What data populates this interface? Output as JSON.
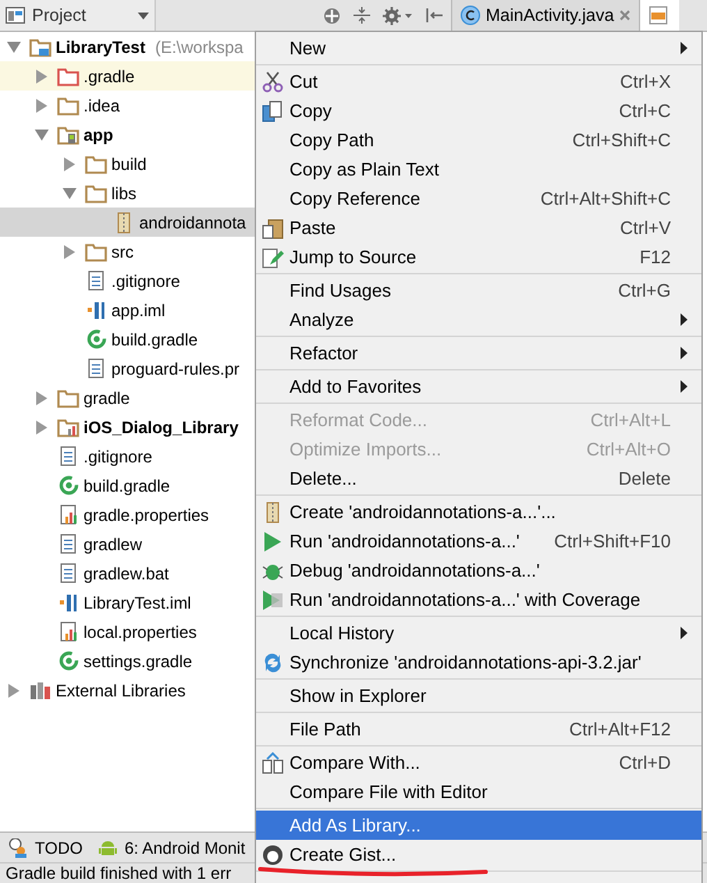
{
  "toolbar": {
    "view_selector": "Project",
    "tabs": [
      {
        "label": "MainActivity.java",
        "kind": "class",
        "selected": false,
        "closable": true
      },
      {
        "kind": "xml",
        "selected": true,
        "closable": false
      }
    ]
  },
  "tree": [
    {
      "label": "LibraryTest",
      "path": "(E:\\workspa",
      "kind": "project",
      "bold": true,
      "expanded": true,
      "selected": false,
      "highlighted": false,
      "children": [
        {
          "label": ".gradle",
          "kind": "excluded-folder",
          "bold": false,
          "expanded": false,
          "selected": false,
          "highlighted": true
        },
        {
          "label": ".idea",
          "kind": "folder",
          "bold": false,
          "expanded": false,
          "selected": false,
          "highlighted": false
        },
        {
          "label": "app",
          "kind": "module",
          "bold": true,
          "expanded": true,
          "selected": false,
          "highlighted": false,
          "children": [
            {
              "label": "build",
              "kind": "folder",
              "bold": false,
              "expanded": false,
              "selected": false,
              "highlighted": false
            },
            {
              "label": "libs",
              "kind": "folder",
              "bold": false,
              "expanded": true,
              "selected": false,
              "highlighted": false,
              "children": [
                {
                  "label": "androidannota",
                  "kind": "jar",
                  "bold": false,
                  "selected": true,
                  "highlighted": false
                }
              ]
            },
            {
              "label": "src",
              "kind": "folder",
              "bold": false,
              "expanded": false,
              "selected": false,
              "highlighted": false
            },
            {
              "label": ".gitignore",
              "kind": "text",
              "bold": false,
              "selected": false,
              "highlighted": false
            },
            {
              "label": "app.iml",
              "kind": "iml",
              "bold": false,
              "selected": false,
              "highlighted": false
            },
            {
              "label": "build.gradle",
              "kind": "gradle",
              "bold": false,
              "selected": false,
              "highlighted": false
            },
            {
              "label": "proguard-rules.pr",
              "kind": "text",
              "bold": false,
              "selected": false,
              "highlighted": false
            }
          ]
        },
        {
          "label": "gradle",
          "kind": "folder",
          "bold": false,
          "expanded": false,
          "selected": false,
          "highlighted": false
        },
        {
          "label": "iOS_Dialog_Library",
          "kind": "library-module",
          "bold": true,
          "expanded": false,
          "selected": false,
          "highlighted": false
        },
        {
          "label": ".gitignore",
          "kind": "text",
          "bold": false,
          "selected": false,
          "highlighted": false
        },
        {
          "label": "build.gradle",
          "kind": "gradle",
          "bold": false,
          "selected": false,
          "highlighted": false
        },
        {
          "label": "gradle.properties",
          "kind": "properties",
          "bold": false,
          "selected": false,
          "highlighted": false
        },
        {
          "label": "gradlew",
          "kind": "text",
          "bold": false,
          "selected": false,
          "highlighted": false
        },
        {
          "label": "gradlew.bat",
          "kind": "text",
          "bold": false,
          "selected": false,
          "highlighted": false
        },
        {
          "label": "LibraryTest.iml",
          "kind": "iml",
          "bold": false,
          "selected": false,
          "highlighted": false
        },
        {
          "label": "local.properties",
          "kind": "properties",
          "bold": false,
          "selected": false,
          "highlighted": false
        },
        {
          "label": "settings.gradle",
          "kind": "gradle",
          "bold": false,
          "selected": false,
          "highlighted": false
        }
      ]
    },
    {
      "label": "External Libraries",
      "kind": "libraries",
      "bold": false,
      "expanded": false,
      "selected": false,
      "highlighted": false
    }
  ],
  "context_menu": {
    "groups": [
      [
        {
          "label": "New",
          "submenu": true,
          "disabled": false,
          "selected": false
        }
      ],
      [
        {
          "label": "Cut",
          "kind": "scissors",
          "shortcut": "Ctrl+X",
          "submenu": false,
          "disabled": false,
          "selected": false
        },
        {
          "label": "Copy",
          "kind": "copy",
          "shortcut": "Ctrl+C",
          "submenu": false,
          "disabled": false,
          "selected": false
        },
        {
          "label": "Copy Path",
          "shortcut": "Ctrl+Shift+C",
          "submenu": false,
          "disabled": false,
          "selected": false
        },
        {
          "label": "Copy as Plain Text",
          "submenu": false,
          "disabled": false,
          "selected": false
        },
        {
          "label": "Copy Reference",
          "shortcut": "Ctrl+Alt+Shift+C",
          "submenu": false,
          "disabled": false,
          "selected": false
        },
        {
          "label": "Paste",
          "kind": "paste",
          "shortcut": "Ctrl+V",
          "submenu": false,
          "disabled": false,
          "selected": false
        },
        {
          "label": "Jump to Source",
          "kind": "pencil",
          "shortcut": "F12",
          "submenu": false,
          "disabled": false,
          "selected": false
        }
      ],
      [
        {
          "label": "Find Usages",
          "shortcut": "Ctrl+G",
          "submenu": false,
          "disabled": false,
          "selected": false
        },
        {
          "label": "Analyze",
          "submenu": true,
          "disabled": false,
          "selected": false
        }
      ],
      [
        {
          "label": "Refactor",
          "submenu": true,
          "disabled": false,
          "selected": false
        }
      ],
      [
        {
          "label": "Add to Favorites",
          "submenu": true,
          "disabled": false,
          "selected": false
        }
      ],
      [
        {
          "label": "Reformat Code...",
          "shortcut": "Ctrl+Alt+L",
          "submenu": false,
          "disabled": true,
          "selected": false
        },
        {
          "label": "Optimize Imports...",
          "shortcut": "Ctrl+Alt+O",
          "submenu": false,
          "disabled": true,
          "selected": false
        },
        {
          "label": "Delete...",
          "shortcut": "Delete",
          "submenu": false,
          "disabled": false,
          "selected": false
        }
      ],
      [
        {
          "label": "Create 'androidannotations-a...'...",
          "kind": "jar",
          "submenu": false,
          "disabled": false,
          "selected": false
        },
        {
          "label": "Run 'androidannotations-a...'",
          "kind": "run",
          "shortcut": "Ctrl+Shift+F10",
          "submenu": false,
          "disabled": false,
          "selected": false
        },
        {
          "label": "Debug 'androidannotations-a...'",
          "kind": "bug",
          "submenu": false,
          "disabled": false,
          "selected": false
        },
        {
          "label": "Run 'androidannotations-a...' with Coverage",
          "kind": "coverage",
          "submenu": false,
          "disabled": false,
          "selected": false
        }
      ],
      [
        {
          "label": "Local History",
          "submenu": true,
          "disabled": false,
          "selected": false
        },
        {
          "label": "Synchronize 'androidannotations-api-3.2.jar'",
          "kind": "sync",
          "submenu": false,
          "disabled": false,
          "selected": false
        }
      ],
      [
        {
          "label": "Show in Explorer",
          "submenu": false,
          "disabled": false,
          "selected": false
        }
      ],
      [
        {
          "label": "File Path",
          "shortcut": "Ctrl+Alt+F12",
          "submenu": false,
          "disabled": false,
          "selected": false
        }
      ],
      [
        {
          "label": "Compare With...",
          "kind": "compare",
          "shortcut": "Ctrl+D",
          "submenu": false,
          "disabled": false,
          "selected": false
        },
        {
          "label": "Compare File with Editor",
          "submenu": false,
          "disabled": false,
          "selected": false
        }
      ],
      [
        {
          "label": "Add As Library...",
          "submenu": false,
          "disabled": false,
          "selected": true
        },
        {
          "label": "Create Gist...",
          "kind": "octocat",
          "submenu": false,
          "disabled": false,
          "selected": false
        }
      ]
    ]
  },
  "tool_windows": [
    {
      "label": "TODO",
      "kind": "todo"
    },
    {
      "label": "6: Android Monit",
      "kind": "android"
    }
  ],
  "status_bar": "Gradle build finished with 1 err"
}
